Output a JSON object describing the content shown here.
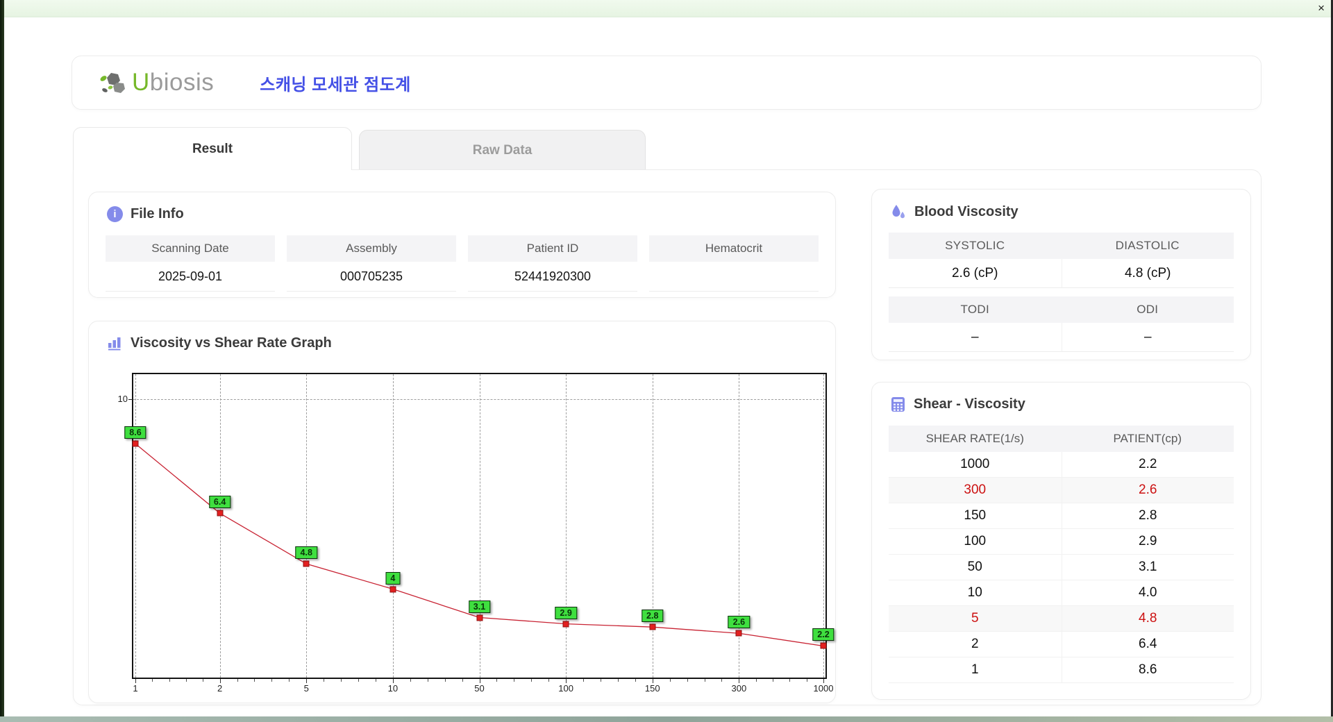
{
  "window": {
    "close_label": "×"
  },
  "header": {
    "logo_u": "U",
    "logo_rest": "biosis",
    "title_korean": "스캐닝 모세관 점도계"
  },
  "tabs": [
    {
      "label": "Result",
      "active": true
    },
    {
      "label": "Raw Data",
      "active": false
    }
  ],
  "file_info": {
    "section_title": "File Info",
    "fields": [
      {
        "label": "Scanning Date",
        "value": "2025-09-01"
      },
      {
        "label": "Assembly",
        "value": "000705235"
      },
      {
        "label": "Patient ID",
        "value": "52441920300"
      },
      {
        "label": "Hematocrit",
        "value": ""
      }
    ]
  },
  "blood_viscosity": {
    "section_title": "Blood Viscosity",
    "group1": {
      "headers": [
        "SYSTOLIC",
        "DIASTOLIC"
      ],
      "values": [
        "2.6 (cP)",
        "4.8 (cP)"
      ]
    },
    "group2": {
      "headers": [
        "TODI",
        "ODI"
      ],
      "values": [
        "–",
        "–"
      ]
    }
  },
  "shear_viscosity": {
    "section_title": "Shear - Viscosity",
    "columns": [
      "SHEAR RATE(1/s)",
      "PATIENT(cp)"
    ],
    "rows": [
      {
        "shear_rate": "1000",
        "patient": "2.2",
        "highlight": false
      },
      {
        "shear_rate": "300",
        "patient": "2.6",
        "highlight": true
      },
      {
        "shear_rate": "150",
        "patient": "2.8",
        "highlight": false
      },
      {
        "shear_rate": "100",
        "patient": "2.9",
        "highlight": false
      },
      {
        "shear_rate": "50",
        "patient": "3.1",
        "highlight": false
      },
      {
        "shear_rate": "10",
        "patient": "4.0",
        "highlight": false
      },
      {
        "shear_rate": "5",
        "patient": "4.8",
        "highlight": true
      },
      {
        "shear_rate": "2",
        "patient": "6.4",
        "highlight": false
      },
      {
        "shear_rate": "1",
        "patient": "8.6",
        "highlight": false
      }
    ]
  },
  "graph": {
    "section_title": "Viscosity vs Shear Rate Graph"
  },
  "chart_data": {
    "type": "line",
    "title": "Viscosity vs Shear Rate Graph",
    "x_ticks": [
      1,
      2,
      5,
      10,
      50,
      100,
      150,
      300,
      1000
    ],
    "x_axis_spacing": "even",
    "xlabel": "",
    "ylabel": "",
    "series": [
      {
        "name": "PATIENT(cp)",
        "values": [
          8.6,
          6.4,
          4.8,
          4.0,
          3.1,
          2.9,
          2.8,
          2.6,
          2.2
        ]
      }
    ],
    "point_labels": [
      "8.6",
      "6.4",
      "4.8",
      "4",
      "3.1",
      "2.9",
      "2.8",
      "2.6",
      "2.2"
    ],
    "y_gridline_value": 10,
    "y_tick_labels": [
      "10"
    ],
    "ylim": [
      1.2,
      10.8
    ],
    "grid": "dashed",
    "legend": "none",
    "line_color": "#c82333",
    "marker_color": "#e32020",
    "point_label_bg": "#3fdf3f"
  },
  "colors": {
    "accent_blue": "#4450e6",
    "icon_indigo": "#848bea",
    "logo_green": "#76b82a",
    "logo_gray": "#9b9b9b",
    "highlight_red": "#cc1111",
    "titlebar_green": "#e9f6e5"
  }
}
